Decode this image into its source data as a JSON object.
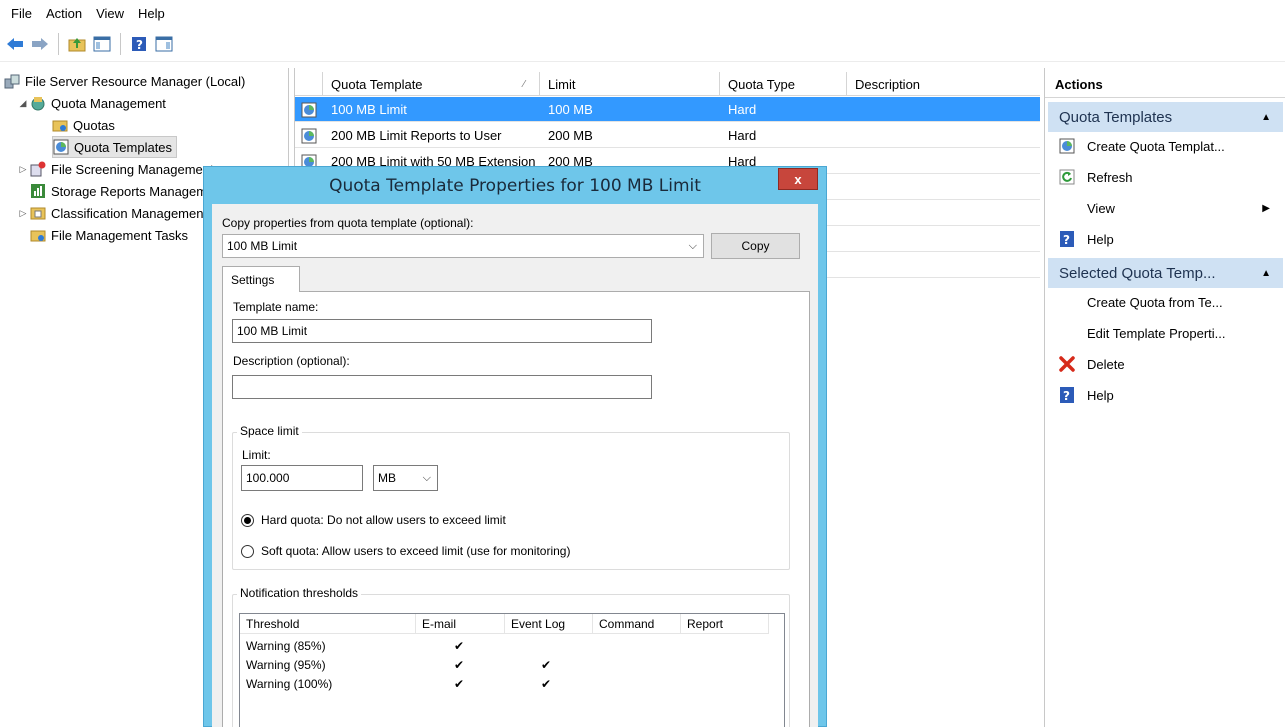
{
  "menu": {
    "items": [
      "File",
      "Action",
      "View",
      "Help"
    ]
  },
  "toolbar": {
    "buttons": [
      "back-icon",
      "forward-icon",
      "up-folder-icon",
      "show-hide-tree-icon",
      "help-icon",
      "show-hide-action-pane-icon"
    ]
  },
  "tree": {
    "root": "File Server Resource Manager (Local)",
    "quota_management": "Quota Management",
    "quotas": "Quotas",
    "quota_templates": "Quota Templates",
    "file_screening": "File Screening Management",
    "storage_reports": "Storage Reports Management",
    "classification": "Classification Management",
    "file_management_tasks": "File Management Tasks"
  },
  "list": {
    "columns": [
      "Quota Template",
      "Limit",
      "Quota Type",
      "Description"
    ],
    "sort_indicator": "⁄",
    "rows": [
      {
        "name": "100 MB Limit",
        "limit": "100 MB",
        "type": "Hard",
        "desc": ""
      },
      {
        "name": "200 MB Limit Reports to User",
        "limit": "200 MB",
        "type": "Hard",
        "desc": ""
      },
      {
        "name": "200 MB Limit with 50 MB Extension",
        "limit": "200 MB",
        "type": "Hard",
        "desc": ""
      }
    ]
  },
  "actions": {
    "title": "Actions",
    "section1": "Quota Templates",
    "section1_items": [
      "Create Quota Templat...",
      "Refresh",
      "View",
      "Help"
    ],
    "section2": "Selected Quota Temp...",
    "section2_items": [
      "Create Quota from Te...",
      "Edit Template Properti...",
      "Delete",
      "Help"
    ]
  },
  "dialog": {
    "title": "Quota Template Properties for 100 MB Limit",
    "close": "x",
    "copy_from_label": "Copy properties from quota template (optional):",
    "copy_from_value": "100 MB Limit",
    "copy_button": "Copy",
    "tab": "Settings",
    "template_name_label": "Template name:",
    "template_name_value": "100 MB Limit",
    "description_label": "Description (optional):",
    "description_value": "",
    "space_limit_title": "Space limit",
    "limit_label": "Limit:",
    "limit_value": "100.000",
    "limit_unit": "MB",
    "hard_quota": "Hard quota: Do not allow users to exceed limit",
    "soft_quota": "Soft quota: Allow users to exceed limit (use for monitoring)",
    "hard_selected": true,
    "notification_title": "Notification thresholds",
    "grid_columns": [
      "Threshold",
      "E-mail",
      "Event Log",
      "Command",
      "Report"
    ],
    "grid_rows": [
      {
        "threshold": "Warning (85%)",
        "email": "✔",
        "eventlog": ""
      },
      {
        "threshold": "Warning (95%)",
        "email": "✔",
        "eventlog": "✔"
      },
      {
        "threshold": "Warning (100%)",
        "email": "✔",
        "eventlog": "✔"
      }
    ]
  }
}
